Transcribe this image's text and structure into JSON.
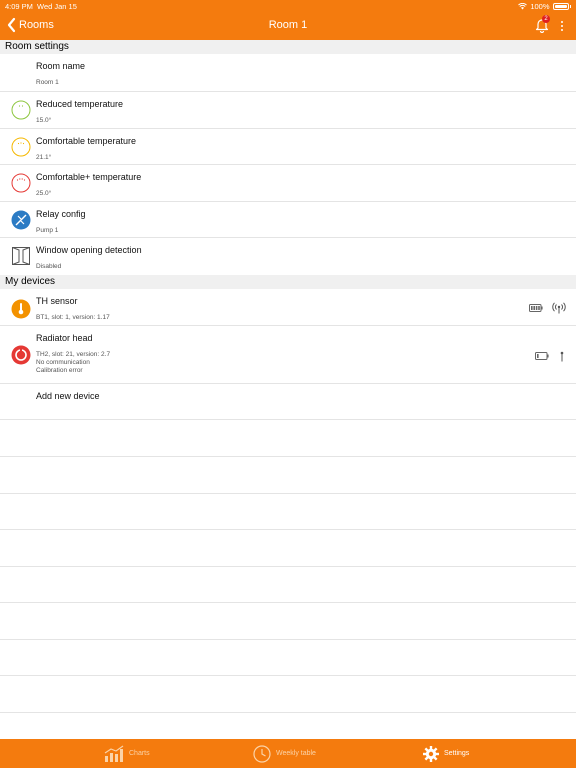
{
  "status_bar": {
    "time": "4:09 PM",
    "date": "Wed Jan 15",
    "battery": "100%"
  },
  "nav": {
    "back_label": "Rooms",
    "title": "Room 1",
    "notification_count": "2"
  },
  "room_settings": {
    "header": "Room settings",
    "items": [
      {
        "title": "Room name",
        "sub": "Room 1"
      },
      {
        "title": "Reduced temperature",
        "sub": "15.0°",
        "color": "#8dc63f"
      },
      {
        "title": "Comfortable temperature",
        "sub": "21.1°",
        "color": "#f5b800"
      },
      {
        "title": "Comfortable+ temperature",
        "sub": "25.0°",
        "color": "#e53935"
      },
      {
        "title": "Relay config",
        "sub": "Pump 1",
        "color": "#2b7bc4"
      },
      {
        "title": "Window opening detection",
        "sub": "Disabled"
      }
    ]
  },
  "devices": {
    "header": "My devices",
    "items": [
      {
        "title": "TH sensor",
        "sub_lines": [
          "BT1, slot: 1, version: 1.17"
        ],
        "icon": "thermometer-icon",
        "color": "#f39200"
      },
      {
        "title": "Radiator head",
        "sub_lines": [
          "TH2, slot: 21, version: 2.7",
          "No communication",
          "Calibration error"
        ],
        "icon": "radiator-head-icon",
        "color": "#e53935"
      }
    ],
    "add_label": "Add new device"
  },
  "tabs": [
    {
      "label": "Charts",
      "icon": "chart-icon",
      "active": false
    },
    {
      "label": "Weekly table",
      "icon": "clock-icon",
      "active": false
    },
    {
      "label": "Settings",
      "icon": "gear-icon",
      "active": true
    }
  ],
  "colors": {
    "accent": "#f47b0e",
    "section_bg": "#f0f0f0"
  }
}
